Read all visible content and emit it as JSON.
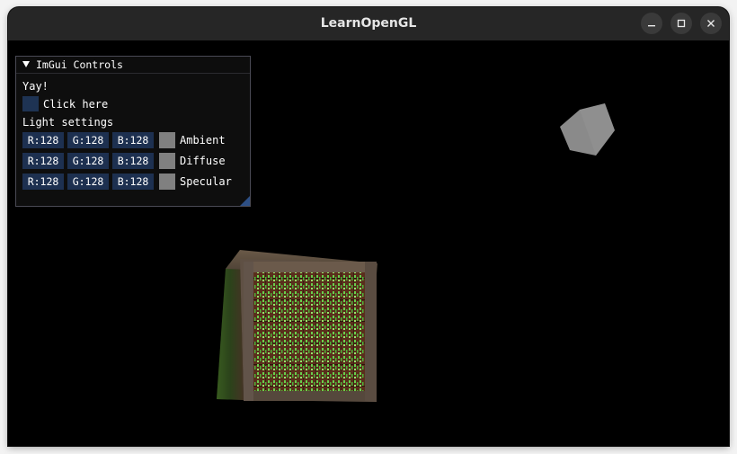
{
  "window": {
    "title": "LearnOpenGL",
    "controls": [
      "minimize-icon",
      "maximize-icon",
      "close-icon"
    ]
  },
  "imgui": {
    "title": "ImGui Controls",
    "text": "Yay!",
    "button_label": "Click here",
    "section_label": "Light settings",
    "lights": [
      {
        "r": "R:128",
        "g": "G:128",
        "b": "B:128",
        "label": "Ambient",
        "swatch": "#808080"
      },
      {
        "r": "R:128",
        "g": "G:128",
        "b": "B:128",
        "label": "Diffuse",
        "swatch": "#808080"
      },
      {
        "r": "R:128",
        "g": "G:128",
        "b": "B:128",
        "label": "Specular",
        "swatch": "#808080"
      }
    ]
  },
  "colors": {
    "background": "#000000",
    "titlebar": "#262626",
    "field": "#1d3050",
    "light_cube": "#8a8a8a",
    "crate_emission": "#5fd14a"
  }
}
